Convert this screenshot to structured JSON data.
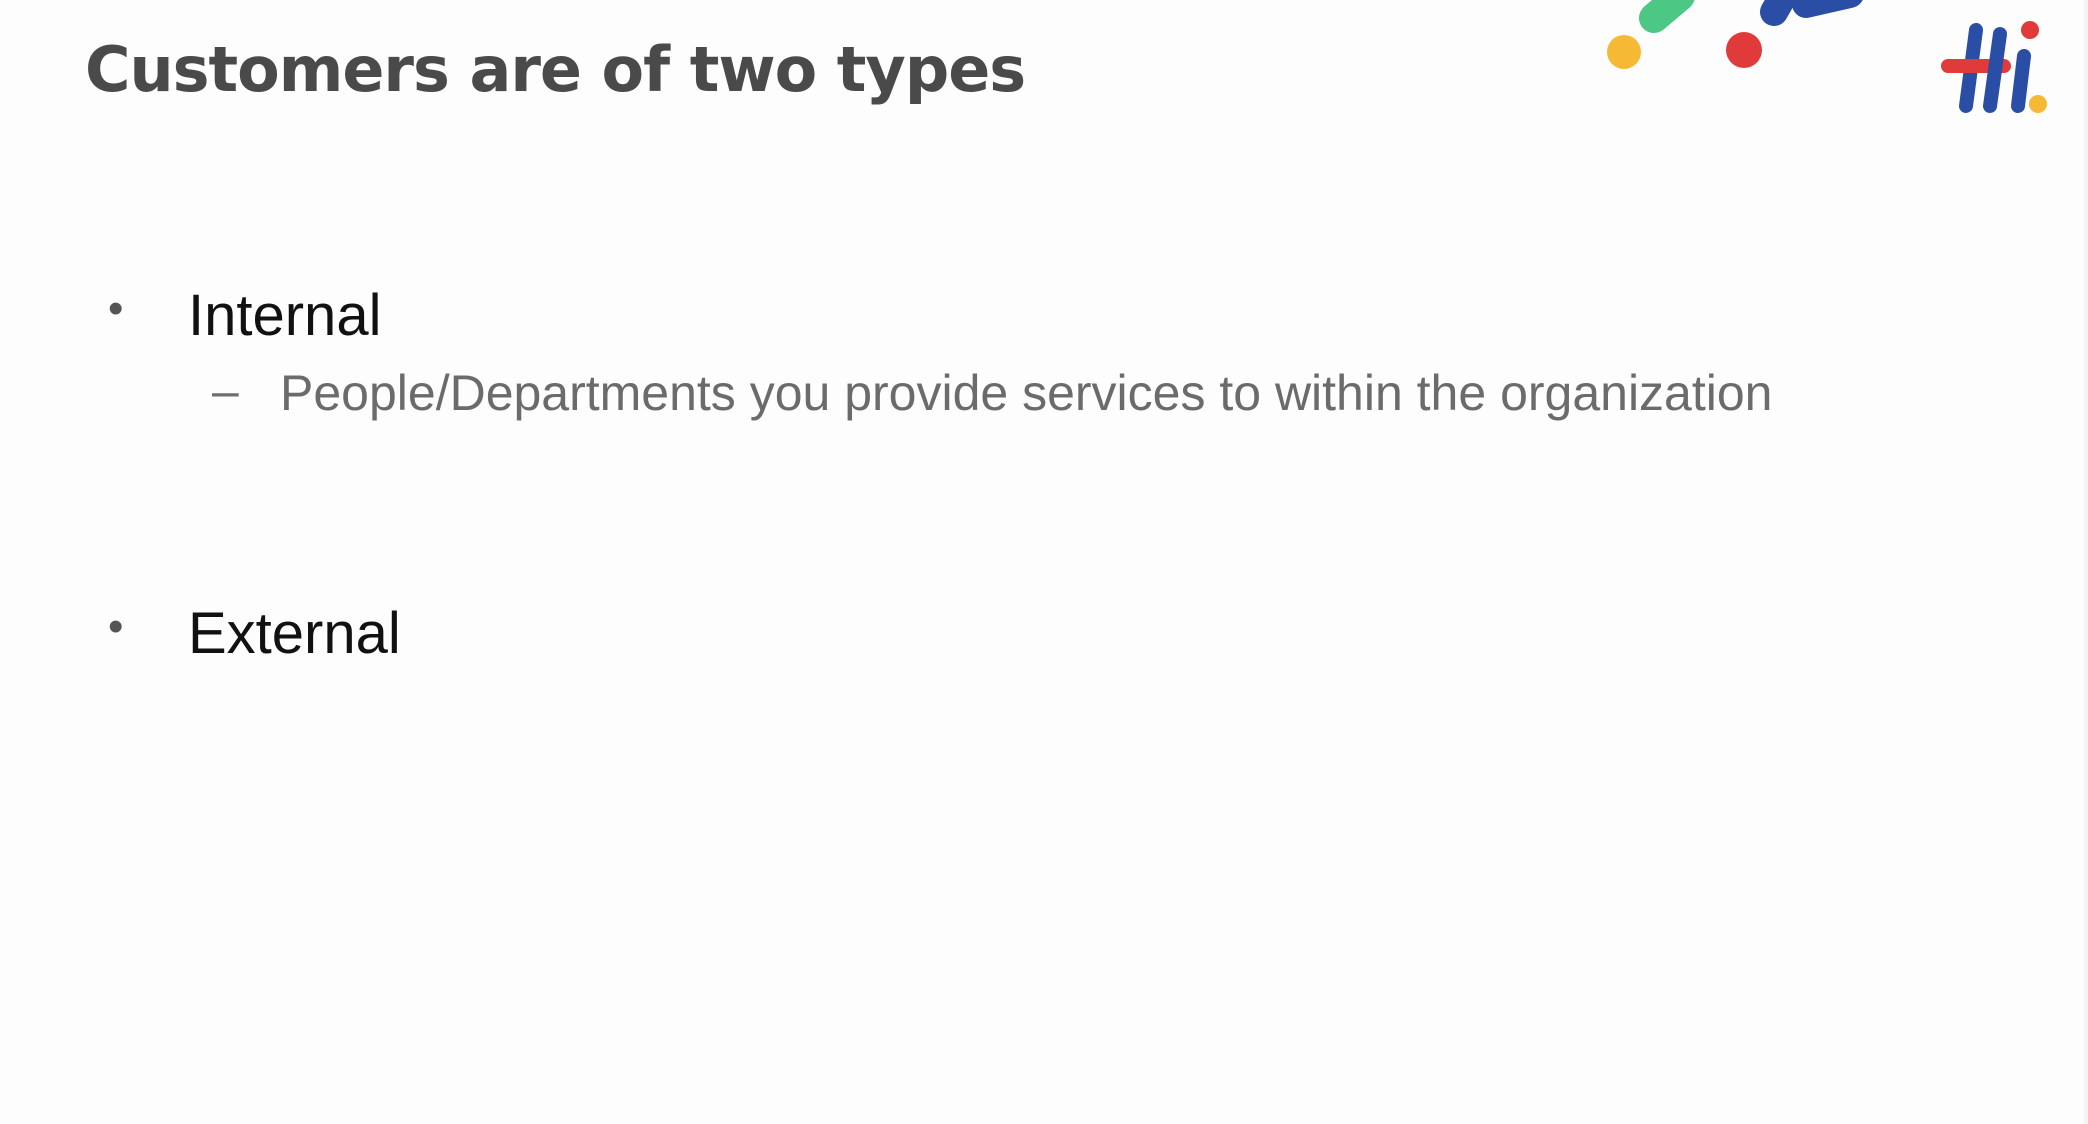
{
  "slide": {
    "title": "Customers are of two types",
    "items": [
      {
        "label": "Internal",
        "sub_items": [
          "People/Departments you provide services to within the organization"
        ]
      },
      {
        "label": "External",
        "sub_items": []
      }
    ],
    "bullet_symbol": "•",
    "dash_symbol": "–"
  },
  "logo": {
    "icon": "hi-logo-icon",
    "colors": {
      "blue": "#2a4ea6",
      "red": "#e03a3a",
      "yellow": "#f5b936",
      "green": "#4cc784"
    }
  }
}
